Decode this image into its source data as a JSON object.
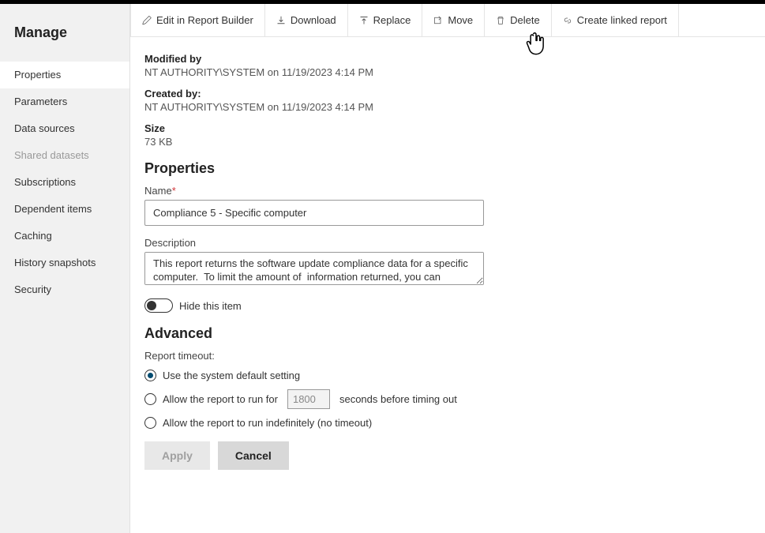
{
  "sidebar": {
    "title": "Manage",
    "items": [
      {
        "label": "Properties",
        "state": "active"
      },
      {
        "label": "Parameters",
        "state": ""
      },
      {
        "label": "Data sources",
        "state": ""
      },
      {
        "label": "Shared datasets",
        "state": "muted"
      },
      {
        "label": "Subscriptions",
        "state": ""
      },
      {
        "label": "Dependent items",
        "state": ""
      },
      {
        "label": "Caching",
        "state": ""
      },
      {
        "label": "History snapshots",
        "state": ""
      },
      {
        "label": "Security",
        "state": ""
      }
    ]
  },
  "toolbar": {
    "edit": "Edit in Report Builder",
    "download": "Download",
    "replace": "Replace",
    "move": "Move",
    "delete": "Delete",
    "linked": "Create linked report"
  },
  "meta": {
    "modified_by_label": "Modified by",
    "modified_by_value": "NT AUTHORITY\\SYSTEM on 11/19/2023 4:14 PM",
    "created_by_label": "Created by:",
    "created_by_value": "NT AUTHORITY\\SYSTEM on 11/19/2023 4:14 PM",
    "size_label": "Size",
    "size_value": "73 KB"
  },
  "properties": {
    "heading": "Properties",
    "name_label": "Name",
    "required_mark": "*",
    "name_value": "Compliance 5 - Specific computer",
    "desc_label": "Description",
    "desc_value": "This report returns the software update compliance data for a specific computer.  To limit the amount of  information returned, you can specify the",
    "hide_label": "Hide this item"
  },
  "advanced": {
    "heading": "Advanced",
    "timeout_label": "Report timeout:",
    "opt1": "Use the system default setting",
    "opt2_pre": "Allow the report to run for",
    "opt2_val": "1800",
    "opt2_post": "seconds before timing out",
    "opt3": "Allow the report to run indefinitely (no timeout)"
  },
  "buttons": {
    "apply": "Apply",
    "cancel": "Cancel"
  }
}
